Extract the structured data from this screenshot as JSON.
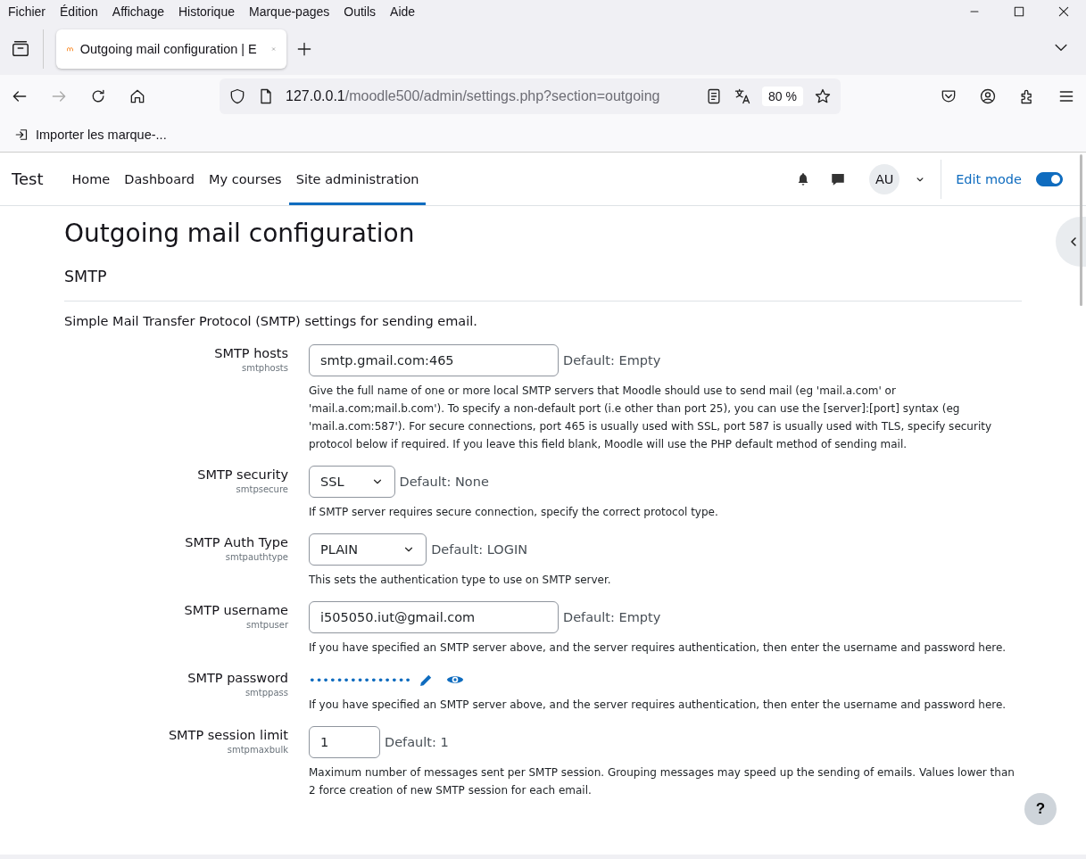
{
  "menu_bar": [
    "Fichier",
    "Édition",
    "Affichage",
    "Historique",
    "Marque-pages",
    "Outils",
    "Aide"
  ],
  "tabs": [
    {
      "title": "Outgoing mail configuration | E",
      "selected": true
    }
  ],
  "address_bar": {
    "host": "127.0.0.1",
    "path": "/moodle500/admin/settings.php?section=outgoing",
    "zoom": "80 %"
  },
  "bookmarks": [
    "Importer les marque-..."
  ],
  "site": {
    "name": "Test",
    "nav": [
      {
        "label": "Home",
        "selected": false
      },
      {
        "label": "Dashboard",
        "selected": false
      },
      {
        "label": "My courses",
        "selected": false
      },
      {
        "label": "Site administration",
        "selected": true
      }
    ],
    "avatar": "AU",
    "edit_mode": {
      "label": "Edit mode",
      "on": true
    }
  },
  "page": {
    "title": "Outgoing mail configuration",
    "section": "SMTP",
    "intro": "Simple Mail Transfer Protocol (SMTP) settings for sending email.",
    "settings": [
      {
        "kind": "text",
        "label": "SMTP hosts",
        "id": "smtphosts",
        "value": "smtp.gmail.com:465",
        "default": "Default: Empty",
        "description": "Give the full name of one or more local SMTP servers that Moodle should use to send mail (eg 'mail.a.com' or 'mail.a.com;mail.b.com'). To specify a non-default port (i.e other than port 25), you can use the [server]:[port] syntax (eg 'mail.a.com:587'). For secure connections, port 465 is usually used with SSL, port 587 is usually used with TLS, specify security protocol below if required. If you leave this field blank, Moodle will use the PHP default method of sending mail."
      },
      {
        "kind": "select",
        "label": "SMTP security",
        "id": "smtpsecure",
        "value": "SSL",
        "default": "Default: None",
        "description": "If SMTP server requires secure connection, specify the correct protocol type."
      },
      {
        "kind": "select",
        "label": "SMTP Auth Type",
        "id": "smtpauthtype",
        "value": "PLAIN",
        "default": "Default: LOGIN",
        "description": "This sets the authentication type to use on SMTP server."
      },
      {
        "kind": "text",
        "label": "SMTP username",
        "id": "smtpuser",
        "value": "i505050.iut@gmail.com",
        "default": "Default: Empty",
        "description": "If you have specified an SMTP server above, and the server requires authentication, then enter the username and password here."
      },
      {
        "kind": "password",
        "label": "SMTP password",
        "id": "smtppass",
        "value": "•••••••••••••••",
        "description": "If you have specified an SMTP server above, and the server requires authentication, then enter the username and password here."
      },
      {
        "kind": "number",
        "label": "SMTP session limit",
        "id": "smtpmaxbulk",
        "value": "1",
        "default": "Default: 1",
        "description": "Maximum number of messages sent per SMTP session. Grouping messages may speed up the sending of emails. Values lower than 2 force creation of new SMTP session for each email."
      }
    ]
  },
  "help_button": "?"
}
